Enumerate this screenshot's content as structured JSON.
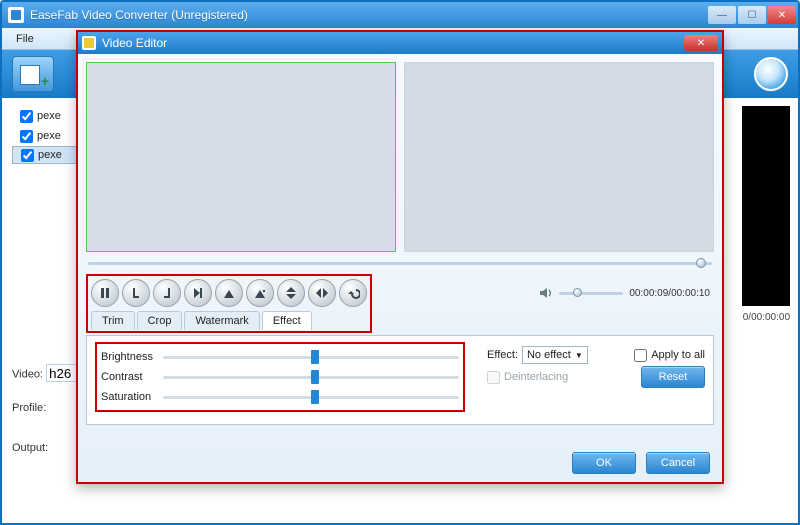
{
  "window": {
    "title": "EaseFab Video Converter (Unregistered)",
    "menu": {
      "file": "File"
    }
  },
  "files": {
    "items": [
      "pexe",
      "pexe",
      "pexe"
    ]
  },
  "labels": {
    "video": "Video:",
    "video_value": "h26",
    "profile": "Profile:",
    "output": "Output:"
  },
  "main_time": "0/00:00:00",
  "dialog": {
    "title": "Video Editor",
    "tabs": {
      "trim": "Trim",
      "crop": "Crop",
      "watermark": "Watermark",
      "effect": "Effect"
    },
    "time": "00:00:09/00:00:10",
    "effects": {
      "brightness": "Brightness",
      "contrast": "Contrast",
      "saturation": "Saturation",
      "effect_label": "Effect:",
      "effect_value": "No effect",
      "apply_all": "Apply to all",
      "deinterlacing": "Deinterlacing",
      "reset": "Reset"
    },
    "buttons": {
      "ok": "OK",
      "cancel": "Cancel"
    }
  },
  "icons": {
    "pb": [
      "pause",
      "mark-in",
      "mark-out",
      "next-frame",
      "rotate-left",
      "rotate-right",
      "flip-v",
      "flip-h",
      "undo"
    ]
  }
}
